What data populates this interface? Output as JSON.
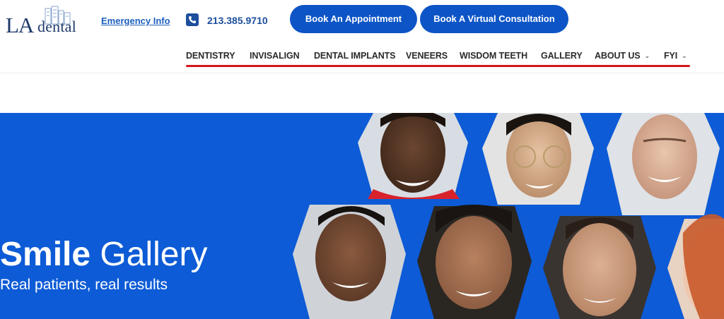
{
  "header": {
    "logo": {
      "text_la": "LA",
      "text_dental": "dental"
    },
    "emergency_link": "Emergency Info",
    "phone": "213.385.9710",
    "book_button": "Book An Appointment",
    "virtual_button": "Book A Virtual Consultation"
  },
  "nav": {
    "items": [
      {
        "label": "DENTISTRY",
        "dropdown": false
      },
      {
        "label": "INVISALIGN",
        "dropdown": false
      },
      {
        "label": "DENTAL IMPLANTS",
        "dropdown": false
      },
      {
        "label": "VENEERS",
        "dropdown": false
      },
      {
        "label": "WISDOM TEETH",
        "dropdown": false
      },
      {
        "label": "GALLERY",
        "dropdown": false
      },
      {
        "label": "ABOUT US",
        "dropdown": true
      },
      {
        "label": "FYI",
        "dropdown": true
      }
    ],
    "chevron": "⌄"
  },
  "hero": {
    "title_bold": "Smile",
    "title_light": "Gallery",
    "subtitle": "Real patients, real results"
  },
  "colors": {
    "brand_blue": "#0d55c6",
    "hero_blue": "#0d5bd6",
    "nav_underline": "#d3151c",
    "logo_navy": "#1f3a6b"
  }
}
